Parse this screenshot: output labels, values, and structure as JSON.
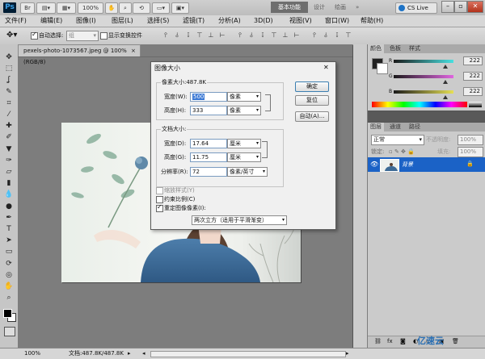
{
  "app": {
    "logo": "Ps",
    "workspace_active": "基本功能",
    "workspace_others": [
      "设计",
      "绘画"
    ],
    "zoom_select": "100%",
    "cs_live": "CS Live",
    "window_buttons": [
      "minimize",
      "maximize",
      "close"
    ]
  },
  "menu": [
    "文件(F)",
    "编辑(E)",
    "图像(I)",
    "图层(L)",
    "选择(S)",
    "滤镜(T)",
    "分析(A)",
    "3D(D)",
    "视图(V)",
    "窗口(W)",
    "帮助(H)"
  ],
  "options_bar": {
    "auto_select_label": "自动选择:",
    "auto_select_checked": true,
    "auto_select_value": "组",
    "show_transform_label": "显示变换控件",
    "show_transform_checked": false
  },
  "document": {
    "tab_title": "pexels-photo-1073567.jpeg @ 100%(RGB/8)",
    "close_symbol": "×"
  },
  "statusbar": {
    "zoom": "100%",
    "doc_info": "文档:487.8K/487.8K"
  },
  "color_panel": {
    "tabs": [
      "颜色",
      "色板",
      "样式"
    ],
    "active_tab": 0,
    "values": [
      "222",
      "222",
      "222"
    ],
    "slider_positions": [
      0.87,
      0.87,
      0.87
    ]
  },
  "layers_panel": {
    "tabs": [
      "图层",
      "通道",
      "路径"
    ],
    "active_tab": 0,
    "blend_mode": "正常",
    "opacity_label": "不透明度:",
    "opacity": "100%",
    "lock_label": "锁定:",
    "fill_label": "填充:",
    "fill": "100%",
    "layer_name": "背景"
  },
  "dialog": {
    "title": "图像大小",
    "close_symbol": "✕",
    "pixel_size_label": "像素大小:487.8K",
    "width_label": "宽度(W):",
    "width_value": "500",
    "width_unit": "像素",
    "height_label": "高度(H):",
    "height_value": "333",
    "height_unit": "像素",
    "doc_size_label": "文档大小:",
    "doc_width_label": "宽度(D):",
    "doc_width_value": "17.64",
    "doc_width_unit": "厘米",
    "doc_height_label": "高度(G):",
    "doc_height_value": "11.75",
    "doc_height_unit": "厘米",
    "resolution_label": "分辨率(R):",
    "resolution_value": "72",
    "resolution_unit": "像素/英寸",
    "scale_styles_label": "缩放样式(Y)",
    "constrain_label": "约束比例(C)",
    "resample_label": "重定图像像素(I):",
    "resample_value": "两次立方（适用于平滑渐变）",
    "ok_label": "确定",
    "reset_label": "复位",
    "auto_label": "自动(A)..."
  },
  "watermark": "亿速云",
  "colors": {
    "accent": "#1b62c6",
    "layer_selected": "#1b62c6",
    "denim": "#3d6a95"
  }
}
